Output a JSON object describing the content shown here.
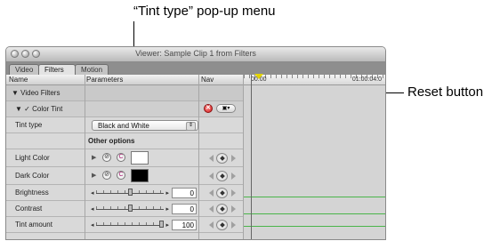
{
  "callouts": {
    "top": "“Tint type” pop-up menu",
    "right": "Reset button"
  },
  "window": {
    "title": "Viewer: Sample Clip 1 from Filters",
    "tabs": [
      {
        "label": "Video"
      },
      {
        "label": "Filters",
        "active": true
      },
      {
        "label": "Motion"
      }
    ]
  },
  "columns": {
    "name": "Name",
    "parameters": "Parameters",
    "nav": "Nav"
  },
  "timeline": {
    "start": "00:00",
    "end": "01:00:04:0",
    "keyframe_line_color": "#4ab54a",
    "playhead_color": "#e3d300"
  },
  "rows": {
    "video_filters": "Video Filters",
    "color_tint": "Color Tint",
    "tint_type_label": "Tint type",
    "tint_type_value": "Black and White",
    "other_options": "Other options",
    "light_color": "Light Color",
    "light_color_value": "#ffffff",
    "dark_color": "Dark Color",
    "dark_color_value": "#000000",
    "brightness": "Brightness",
    "brightness_value": "0",
    "contrast": "Contrast",
    "contrast_value": "0",
    "tint_amount": "Tint amount",
    "tint_amount_value": "100"
  },
  "sliders": {
    "brightness_fraction": 0.5,
    "contrast_fraction": 0.5,
    "tint_amount_fraction": 1.0
  },
  "icons": {
    "reset": "reset-x-icon",
    "eyedropper": "eyedropper-icon",
    "color_wheel": "color-picker-icon"
  }
}
